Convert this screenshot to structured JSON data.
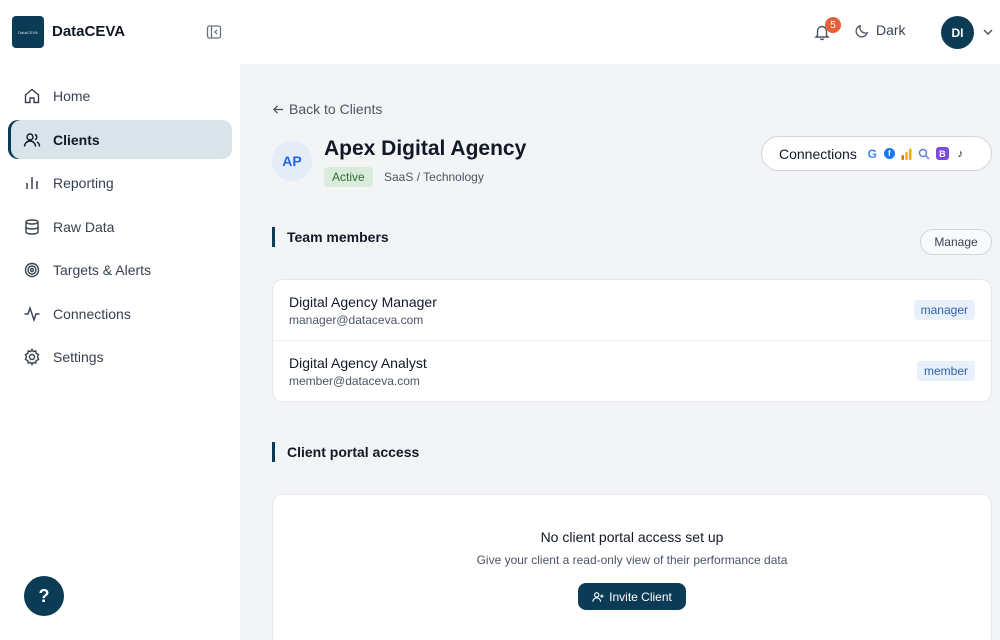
{
  "app": {
    "brand": "DataCEVA",
    "logo_text": "DataCEVA",
    "notifications_count": "5",
    "theme_label": "Dark",
    "user_initials": "DI"
  },
  "sidebar": {
    "items": [
      {
        "label": "Home",
        "icon": "home-icon"
      },
      {
        "label": "Clients",
        "icon": "users-icon",
        "active": true
      },
      {
        "label": "Reporting",
        "icon": "bar-chart-icon"
      },
      {
        "label": "Raw Data",
        "icon": "database-icon"
      },
      {
        "label": "Targets & Alerts",
        "icon": "target-icon"
      },
      {
        "label": "Connections",
        "icon": "activity-icon"
      },
      {
        "label": "Settings",
        "icon": "gear-icon"
      }
    ],
    "help_label": "?"
  },
  "main": {
    "back_label": "Back to Clients",
    "client": {
      "initials": "AP",
      "name": "Apex Digital Agency",
      "status": "Active",
      "industry": "SaaS / Technology"
    },
    "connections_label": "Connections",
    "connection_icons": [
      {
        "name": "google-icon",
        "glyph": "G",
        "color": "#4285f4"
      },
      {
        "name": "facebook-icon",
        "glyph": "f",
        "color": "#1877f2"
      },
      {
        "name": "analytics-icon",
        "glyph": "",
        "color": "#f4a300"
      },
      {
        "name": "search-console-icon",
        "glyph": "",
        "color": "#5b7fd6"
      },
      {
        "name": "bing-icon",
        "glyph": "B",
        "color": "#7c4dd6"
      },
      {
        "name": "tiktok-icon",
        "glyph": "♪",
        "color": "#111111"
      }
    ],
    "team": {
      "title": "Team members",
      "manage_label": "Manage",
      "members": [
        {
          "name": "Digital Agency Manager",
          "email": "manager@dataceva.com",
          "role": "manager"
        },
        {
          "name": "Digital Agency Analyst",
          "email": "member@dataceva.com",
          "role": "member"
        }
      ]
    },
    "portal": {
      "title": "Client portal access",
      "empty_title": "No client portal access set up",
      "empty_desc": "Give your client a read-only view of their performance data",
      "invite_label": "Invite Client"
    }
  },
  "colors": {
    "primary": "#0b3b55",
    "badge": "#e8603a",
    "active_bg": "#d8e4ea"
  }
}
